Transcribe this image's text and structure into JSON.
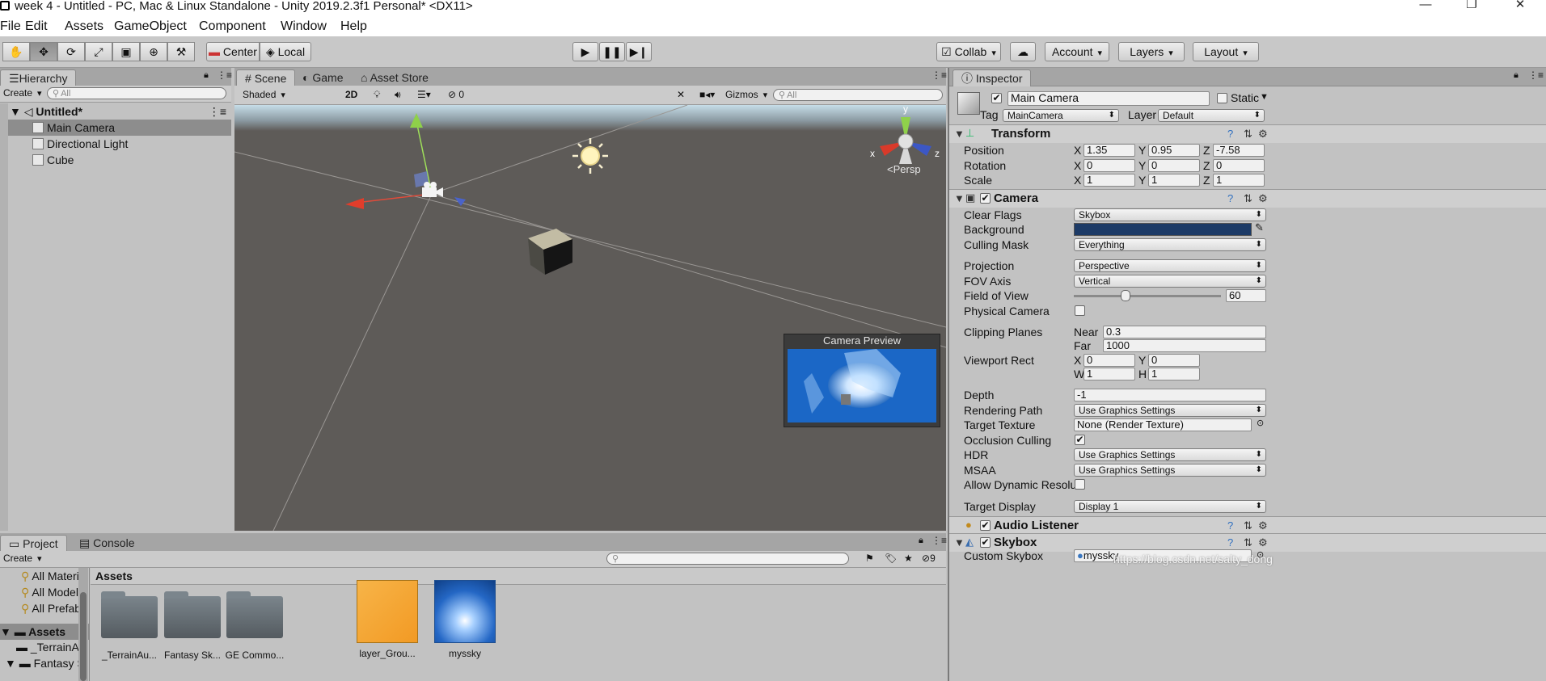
{
  "window": {
    "title": "week 4 - Untitled - PC, Mac & Linux Standalone - Unity 2019.2.3f1 Personal* <DX11>",
    "controls": [
      "—",
      "❐",
      "✕"
    ]
  },
  "menu": [
    "File",
    "Edit",
    "Assets",
    "GameObject",
    "Component",
    "Window",
    "Help"
  ],
  "toolbar": {
    "pivot": "Center",
    "space": "Local",
    "collab": "Collab",
    "account": "Account",
    "layers": "Layers",
    "layout": "Layout"
  },
  "hierarchy": {
    "tab": "Hierarchy",
    "create": "Create",
    "search_placeholder": "All",
    "scene": "Untitled*",
    "items": [
      "Main Camera",
      "Directional Light",
      "Cube"
    ]
  },
  "scene_tabs": [
    "Scene",
    "Game",
    "Asset Store"
  ],
  "scene_bar": {
    "shading": "Shaded",
    "mode_2d": "2D",
    "hidden_count": "0",
    "gizmos": "Gizmos",
    "search_placeholder": "All"
  },
  "scene_view": {
    "persp_label": "<Persp",
    "axis_x": "x",
    "axis_y": "y",
    "axis_z": "z",
    "camera_preview": "Camera Preview"
  },
  "project": {
    "tabs": [
      "Project",
      "Console"
    ],
    "create": "Create",
    "favorites": [
      "All Materi",
      "All Models",
      "All Prefab"
    ],
    "tree": [
      "Assets",
      "_TerrainA",
      "Fantasy S"
    ],
    "breadcrumb": "Assets",
    "visible_count": "9",
    "assets": [
      "_TerrainAu...",
      "Fantasy Sk...",
      "GE Commo...",
      "layer_Grou...",
      "myssky"
    ]
  },
  "inspector": {
    "tab": "Inspector",
    "object_name": "Main Camera",
    "static_label": "Static",
    "tag_label": "Tag",
    "tag_value": "MainCamera",
    "layer_label": "Layer",
    "layer_value": "Default",
    "transform": {
      "title": "Transform",
      "position_label": "Position",
      "position": [
        "1.35",
        "0.95",
        "-7.58"
      ],
      "rotation_label": "Rotation",
      "rotation": [
        "0",
        "0",
        "0"
      ],
      "scale_label": "Scale",
      "scale": [
        "1",
        "1",
        "1"
      ]
    },
    "camera": {
      "title": "Camera",
      "clear_flags_label": "Clear Flags",
      "clear_flags": "Skybox",
      "background_label": "Background",
      "background_color": "#1c3a66",
      "culling_mask_label": "Culling Mask",
      "culling_mask": "Everything",
      "projection_label": "Projection",
      "projection": "Perspective",
      "fov_axis_label": "FOV Axis",
      "fov_axis": "Vertical",
      "fov_label": "Field of View",
      "fov": "60",
      "fov_fraction": 0.347,
      "physical_label": "Physical Camera",
      "clipping_label": "Clipping Planes",
      "near_label": "Near",
      "near": "0.3",
      "far_label": "Far",
      "far": "1000",
      "viewport_label": "Viewport Rect",
      "vx": "0",
      "vy": "0",
      "vw": "1",
      "vh": "1",
      "depth_label": "Depth",
      "depth": "-1",
      "rendering_path_label": "Rendering Path",
      "rendering_path": "Use Graphics Settings",
      "target_texture_label": "Target Texture",
      "target_texture": "None (Render Texture)",
      "occlusion_label": "Occlusion Culling",
      "hdr_label": "HDR",
      "hdr": "Use Graphics Settings",
      "msaa_label": "MSAA",
      "msaa": "Use Graphics Settings",
      "dynres_label": "Allow Dynamic Resolutio",
      "target_display_label": "Target Display",
      "target_display": "Display 1"
    },
    "audio_listener": "Audio Listener",
    "skybox": {
      "title": "Skybox",
      "custom_label": "Custom Skybox",
      "custom_value": "myssky"
    }
  },
  "watermark": "https://blog.csdn.net/salty_dong"
}
